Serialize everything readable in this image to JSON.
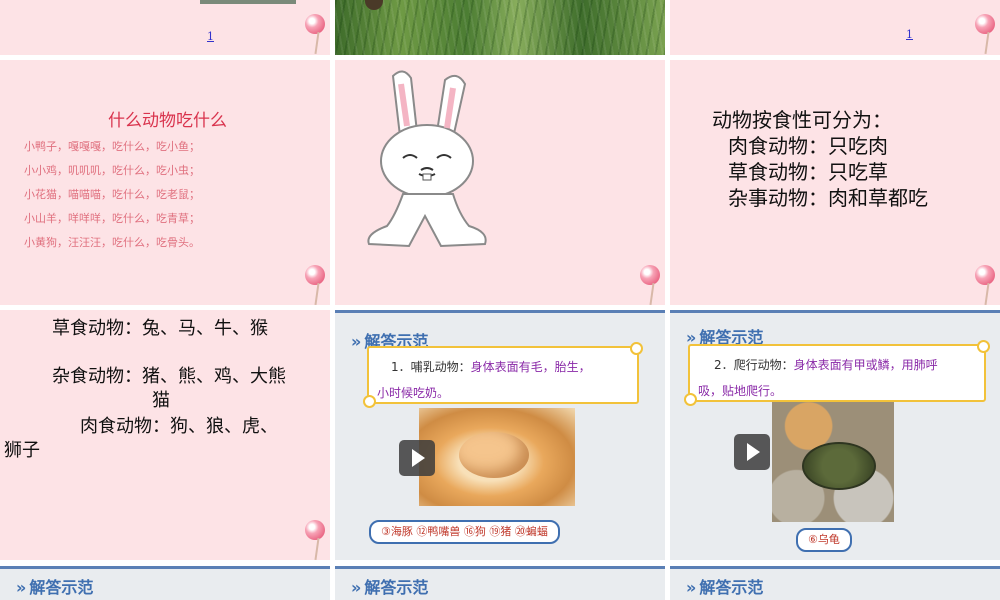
{
  "slides": {
    "top_left": {
      "page_number": "1"
    },
    "top_right": {
      "page_number": "1"
    },
    "poem": {
      "title": "什么动物吃什么",
      "lines": [
        "小鸭子，嘎嘎嘎，吃什么，吃小鱼；",
        "小小鸡，叽叽叽，吃什么，吃小虫；",
        "小花猫，喵喵喵，吃什么，吃老鼠；",
        "小山羊，咩咩咩，吃什么，吃青草；",
        "小黄狗，汪汪汪，吃什么，吃骨头。"
      ]
    },
    "diet_types": {
      "heading": "动物按食性可分为：",
      "items": [
        "肉食动物：只吃肉",
        "草食动物：只吃草",
        "杂事动物：肉和草都吃"
      ]
    },
    "animal_lists": {
      "herbivore": "草食动物：兔、马、牛、猴",
      "omnivore_1": "杂食动物：猪、熊、鸡、大熊",
      "omnivore_2": "猫",
      "carnivore_1": "肉食动物：狗、狼、虎、",
      "carnivore_2": "狮子"
    },
    "mammal": {
      "title": "解答示范",
      "label": "1．哺乳动物：",
      "desc": "身体表面有毛，胎生，",
      "desc2": "小时候吃奶。",
      "answer": "③海豚  ⑫鸭嘴兽  ⑯狗  ⑲猪  ⑳蝙蝠"
    },
    "reptile": {
      "title": "解答示范",
      "label": "2．爬行动物：",
      "desc": "身体表面有甲或鳞，用肺呼",
      "desc2": "吸，贴地爬行。",
      "answer": "⑥乌龟"
    },
    "bottom": {
      "titles": [
        "解答示范",
        "解答示范",
        "解答示范"
      ]
    }
  },
  "colors": {
    "pink_bg": "#fde3e6",
    "gray_bg": "#e9ecef",
    "title_blue": "#3f6fb0",
    "scroll_gold": "#f2c23a",
    "highlight_purple": "#8a2aa8"
  }
}
